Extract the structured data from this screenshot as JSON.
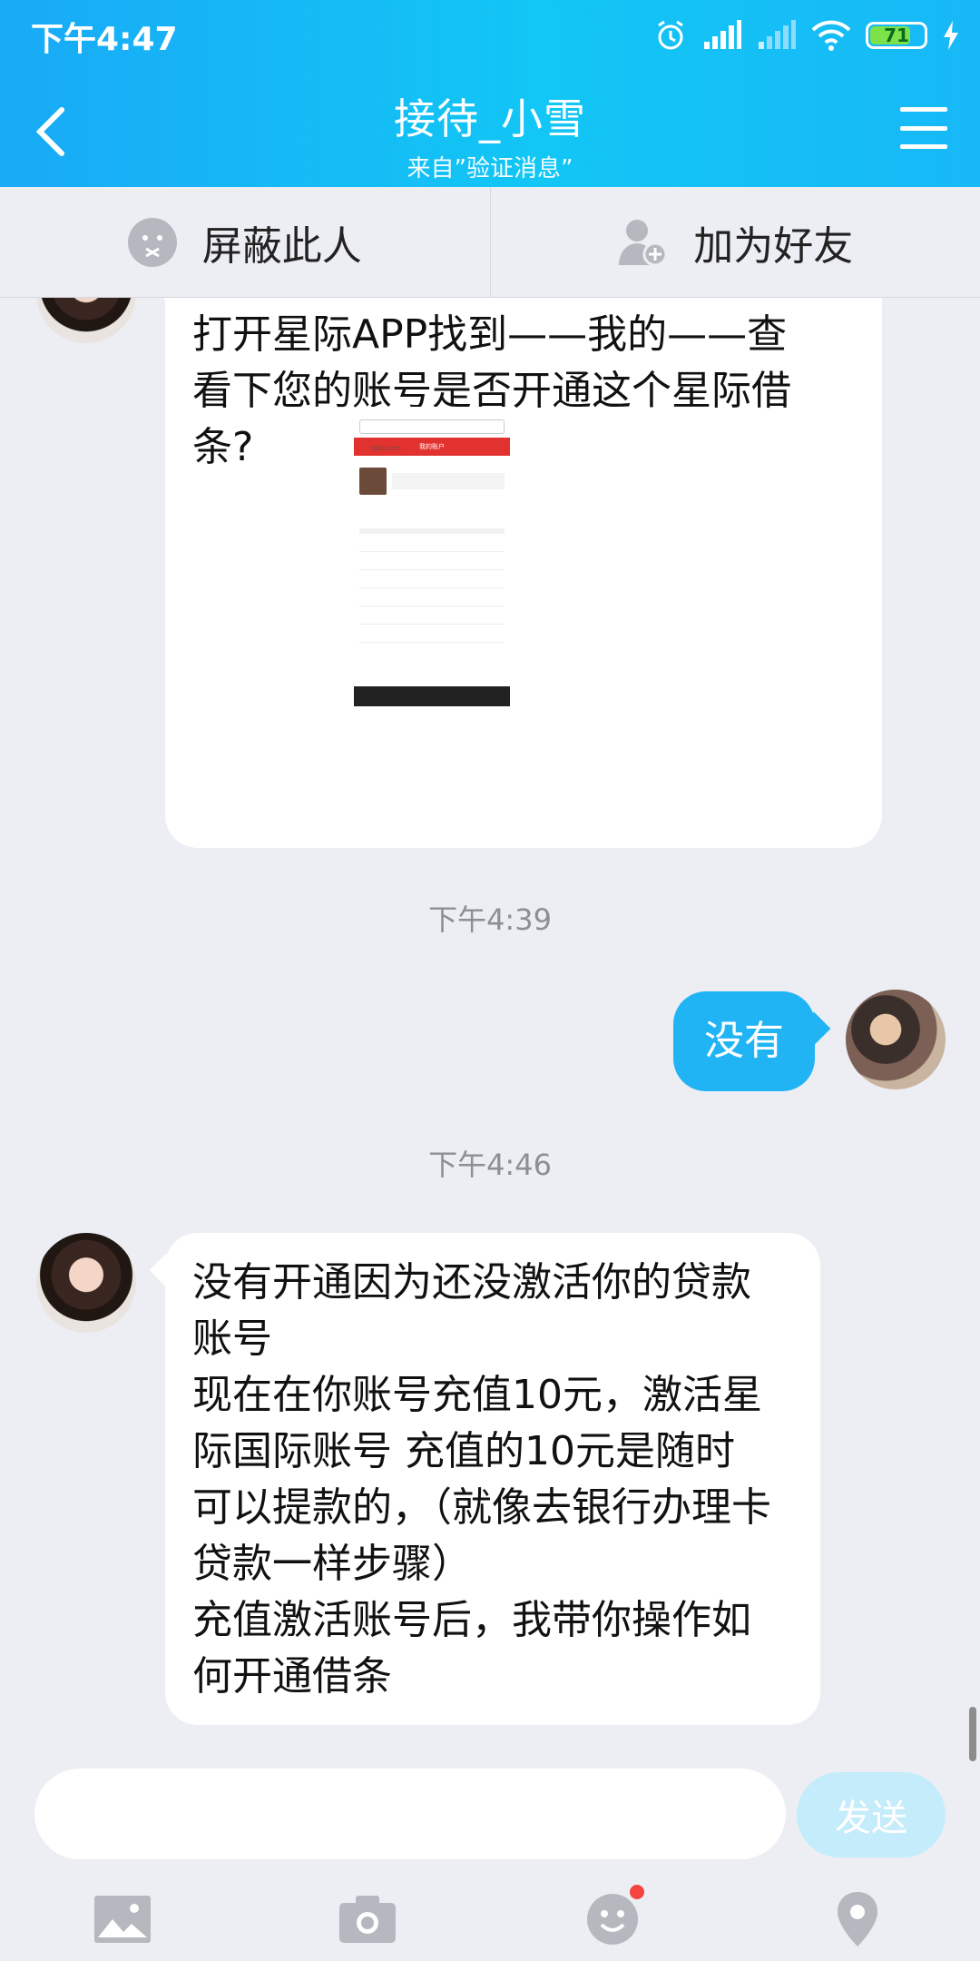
{
  "status": {
    "time": "下午4:47",
    "battery": "71"
  },
  "header": {
    "title": "接待_小雪",
    "subtitle": "来自”验证消息”"
  },
  "actions": {
    "block": "屏蔽此人",
    "add_friend": "加为好友"
  },
  "messages": [
    {
      "from": "other",
      "text": "打开星际APP找到——我的——查\n看下您的账号是否开通这个星际借\n条?"
    },
    {
      "timestamp": "下午4:39"
    },
    {
      "from": "self",
      "text": "没有"
    },
    {
      "timestamp": "下午4:46"
    },
    {
      "from": "other",
      "text": "没有开通因为还没激活你的贷款\n账号\n现在在你账号充值10元，激活星\n际国际账号 充值的10元是随时\n可以提款的，（就像去银行办理卡\n贷款一样步骤）\n充值激活账号后，我带你操作如\n何开通借条"
    }
  ],
  "thumbnail": {
    "url": "xj60.com",
    "header": "我的账户"
  },
  "input": {
    "placeholder": "",
    "send_label": "发送"
  },
  "toolbar": [
    "image-icon",
    "camera-icon",
    "emoji-icon",
    "location-icon"
  ],
  "colors": {
    "header": "#19aaf6",
    "self_bubble": "#21b4f5",
    "send_disabled": "#c5ecfa"
  }
}
